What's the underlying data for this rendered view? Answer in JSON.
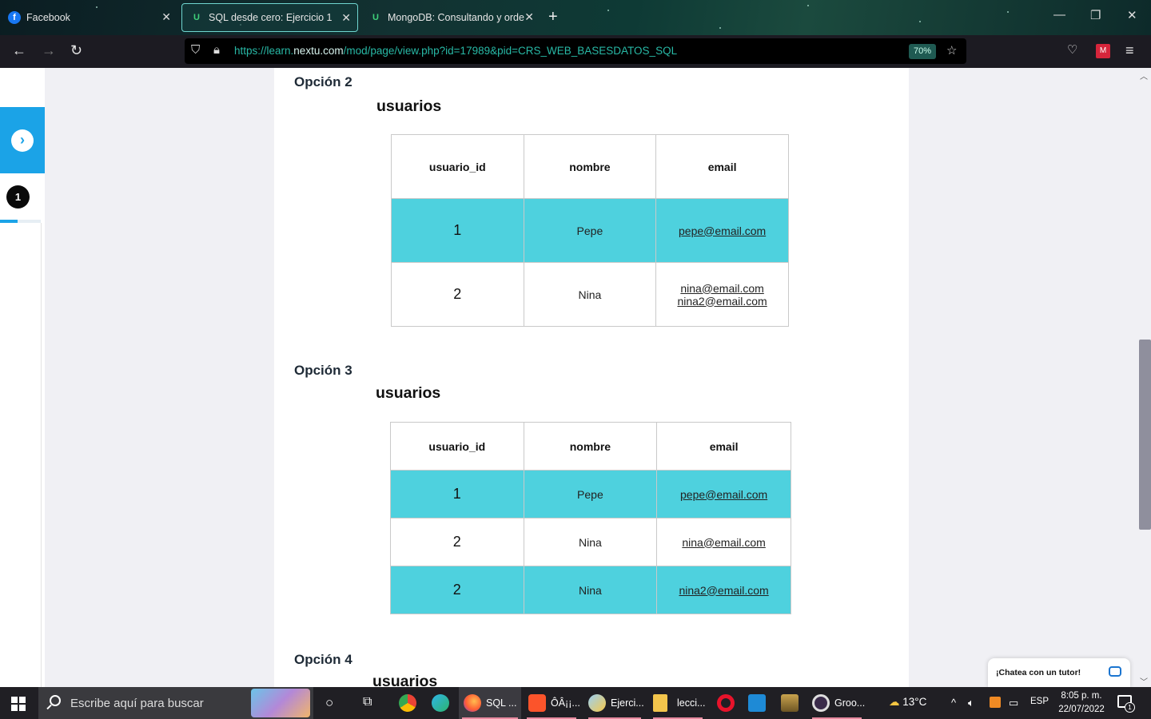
{
  "browser": {
    "tabs": [
      {
        "label": "Facebook"
      },
      {
        "label": "SQL desde cero: Ejercicio 1"
      },
      {
        "label": "MongoDB: Consultando y orde"
      }
    ],
    "url_prefix": "https://learn.",
    "url_domain": "nextu.com",
    "url_path": "/mod/page/view.php?id=17989&pid=CRS_WEB_BASESDATOS_SQL",
    "zoom": "70%"
  },
  "sidebar": {
    "step_number": "1",
    "progress_fraction": 0.43
  },
  "content": {
    "option2": {
      "heading": "Opción 2",
      "table_title": "usuarios",
      "columns": [
        "usuario_id",
        "nombre",
        "email"
      ],
      "rows": [
        {
          "id": "1",
          "nombre": "Pepe",
          "email": "pepe@email.com"
        },
        {
          "id": "2",
          "nombre": "Nina",
          "email": "nina@email.com",
          "email2": "nina2@email.com"
        }
      ]
    },
    "option3": {
      "heading": "Opción 3",
      "table_title": "usuarios",
      "columns": [
        "usuario_id",
        "nombre",
        "email"
      ],
      "rows": [
        {
          "id": "1",
          "nombre": "Pepe",
          "email": "pepe@email.com"
        },
        {
          "id": "2",
          "nombre": "Nina",
          "email": "nina@email.com"
        },
        {
          "id": "2",
          "nombre": "Nina",
          "email": "nina2@email.com"
        }
      ]
    },
    "option4": {
      "heading": "Opción 4",
      "table_title": "usuarios"
    },
    "colors": {
      "highlight_row": "#4ed1de",
      "accent": "#1ba3e7"
    }
  },
  "chat": {
    "label": "¡Chatea con un tutor!"
  },
  "taskbar": {
    "search_placeholder": "Escribe aquí para buscar",
    "apps": [
      {
        "label": "SQL ..."
      },
      {
        "label": "ÔÂ¡¡..."
      },
      {
        "label": "Ejerci..."
      },
      {
        "label": "lecci..."
      },
      {
        "label": "Groo..."
      }
    ],
    "weather": "13°C",
    "language": "ESP",
    "time": "8:05 p. m.",
    "date": "22/07/2022",
    "notifications": "1"
  }
}
